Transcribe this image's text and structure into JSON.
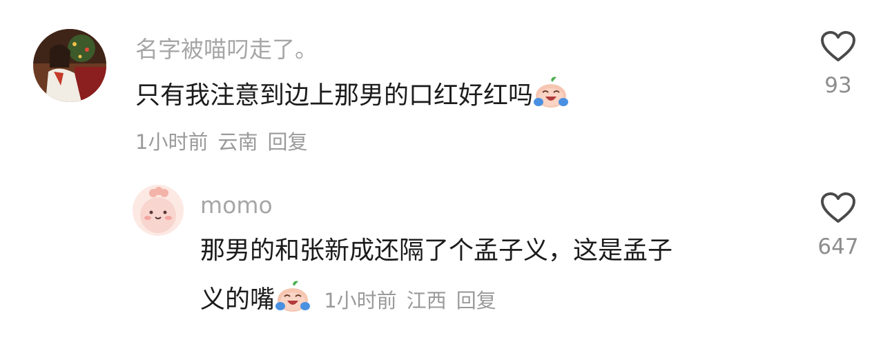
{
  "comments": [
    {
      "username": "名字被喵叼走了。",
      "text": "只有我注意到边上那男的口红好红吗",
      "time": "1小时前",
      "location": "云南",
      "reply_label": "回复",
      "likes": "93",
      "avatar_icon": "user-photo-avatar",
      "emoji_icon": "crying-laughing-emoji"
    },
    {
      "username": "momo",
      "text_line1": "那男的和张新成还隔了个孟子义，这是孟子",
      "text_line2": "义的嘴",
      "time": "1小时前",
      "location": "江西",
      "reply_label": "回复",
      "likes": "647",
      "avatar_icon": "pink-creature-avatar",
      "emoji_icon": "crying-laughing-emoji"
    }
  ],
  "colors": {
    "username": "#a6a6a6",
    "text": "#1b1b1b",
    "meta": "#9a9a9a",
    "like_count": "#8d8d8d"
  }
}
